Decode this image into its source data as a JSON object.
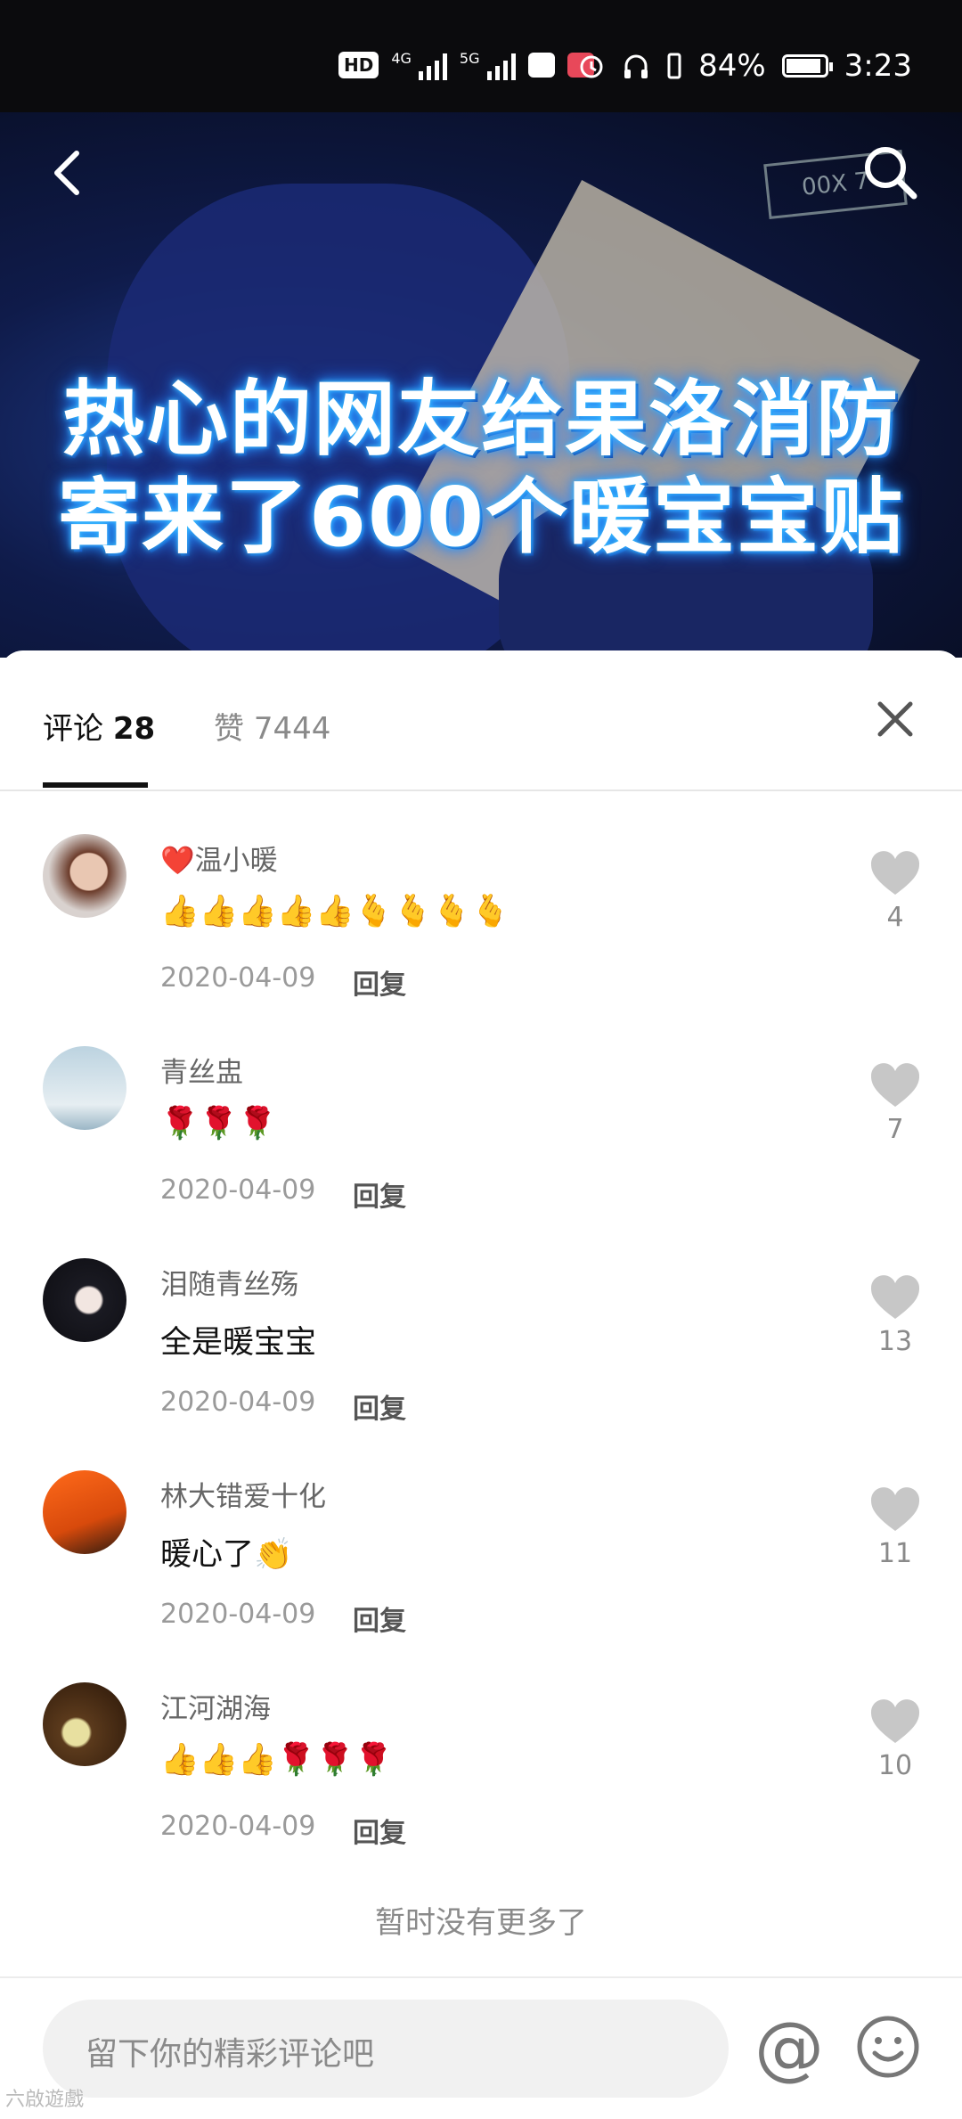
{
  "status_bar": {
    "hd": "HD",
    "net1": "4G",
    "net2": "5G",
    "battery": "84%",
    "time": "3:23"
  },
  "video": {
    "caption_line1": "热心的网友给果洛消防",
    "caption_line2": "寄来了600个暖宝宝贴",
    "plate_text": "00X 7",
    "back_icon": "chevron-left-icon",
    "search_icon": "search-icon"
  },
  "tabs": {
    "comments_label": "评论",
    "comments_count": "28",
    "likes_label": "赞",
    "likes_count": "7444",
    "close_icon": "close-icon"
  },
  "comments": [
    {
      "name": "❤️温小暖",
      "text": "👍👍👍👍👍🫰🫰🫰🫰",
      "date": "2020-04-09",
      "reply": "回复",
      "likes": "4"
    },
    {
      "name": "青丝盅",
      "text": "🌹🌹🌹",
      "date": "2020-04-09",
      "reply": "回复",
      "likes": "7"
    },
    {
      "name": "泪随青丝殇",
      "text": "全是暖宝宝",
      "date": "2020-04-09",
      "reply": "回复",
      "likes": "13"
    },
    {
      "name": "林大错爱十化",
      "text": "暖心了👏",
      "date": "2020-04-09",
      "reply": "回复",
      "likes": "11"
    },
    {
      "name": "江河湖海",
      "text": "👍👍👍🌹🌹🌹",
      "date": "2020-04-09",
      "reply": "回复",
      "likes": "10"
    }
  ],
  "end_text": "暂时没有更多了",
  "input": {
    "placeholder": "留下你的精彩评论吧",
    "at_symbol": "@",
    "emoji_icon": "smiley-icon"
  },
  "watermark": "六啟遊戲"
}
